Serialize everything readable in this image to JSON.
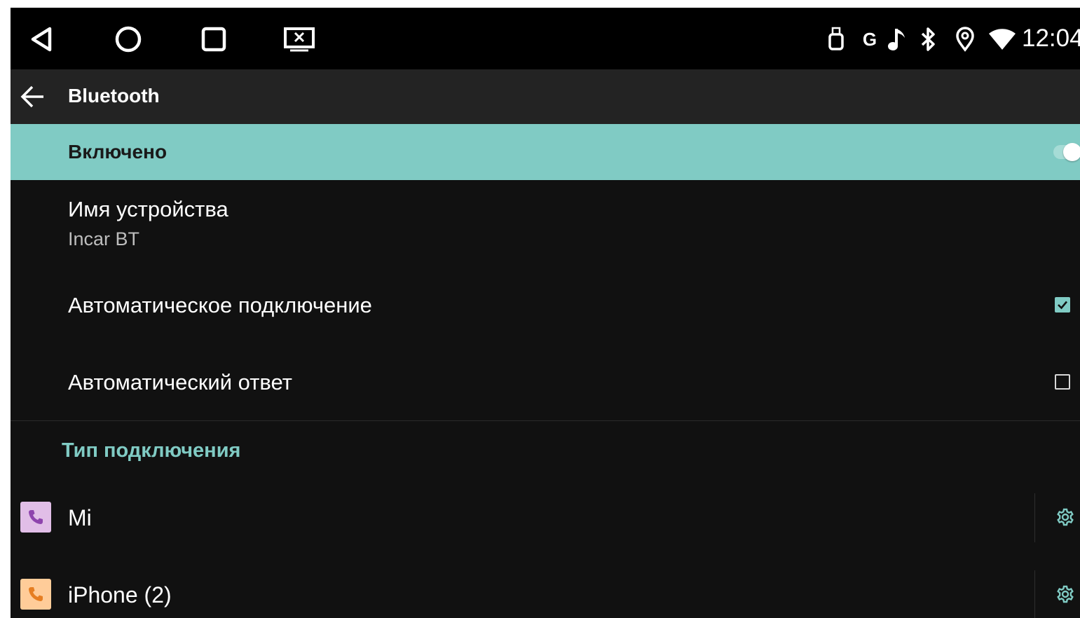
{
  "status_bar": {
    "time": "12:04",
    "g_indicator": "G",
    "nav_icons": [
      "back-triangle-icon",
      "home-circle-icon",
      "recents-square-icon",
      "screen-close-icon"
    ],
    "status_icons": [
      "usb-icon",
      "g-indicator",
      "music-note-icon",
      "bluetooth-icon",
      "location-icon",
      "wifi-icon"
    ]
  },
  "app_bar": {
    "title": "Bluetooth"
  },
  "master_switch": {
    "label": "Включено",
    "on": true
  },
  "preferences": {
    "device_name": {
      "title": "Имя устройства",
      "value": "Incar BT"
    },
    "auto_connect": {
      "title": "Автоматическое подключение",
      "checked": true
    },
    "auto_answer": {
      "title": "Автоматический ответ",
      "checked": false
    }
  },
  "category": {
    "title": "Тип подключения"
  },
  "devices": [
    {
      "name": "Mi",
      "icon": "phone-icon",
      "icon_color": "#e1bee7"
    },
    {
      "name": "iPhone (2)",
      "icon": "phone-icon",
      "icon_color": "#ffcc99"
    }
  ],
  "colors": {
    "accent": "#80cbc4",
    "background": "#111111",
    "app_bar": "#232323",
    "status_bar": "#000000"
  }
}
